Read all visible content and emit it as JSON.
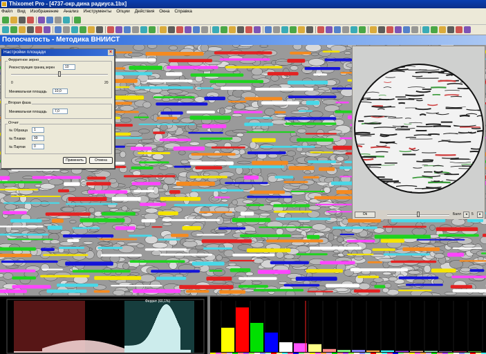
{
  "window": {
    "title": "Thixomet Pro - [4737-окр.дина радиуса.1bx]"
  },
  "menu": [
    "Файл",
    "Вид",
    "Изображение",
    "Анализ",
    "Инструменты",
    "Опции",
    "Действия",
    "Окна",
    "Справка"
  ],
  "document": {
    "title": "Полосчатость - Методика ВНИИСТ"
  },
  "dialog": {
    "title": "Настройки площади",
    "groups": {
      "ferrite": {
        "label": "Ферритное зерно",
        "reconstruct_label": "Реконструкция границ зерен",
        "reconstruct_value": "10",
        "slider_min": "0",
        "slider_max": "20",
        "slider_level": 0.5,
        "min_area_label": "Минимальная площадь",
        "min_area_value": "10,0"
      },
      "second_phase": {
        "label": "Вторая фаза",
        "min_area_label": "Минимальная площадь",
        "min_area_value": "7,0"
      },
      "report": {
        "label": "Отчет",
        "sample_label": "№ Образца",
        "sample_value": "1",
        "melt_label": "№ Плавки",
        "melt_value": "99",
        "batch_label": "№ Партии",
        "batch_value": "0"
      }
    },
    "apply_label": "Применить",
    "cancel_label": "Отмена"
  },
  "zoom_view": {
    "ok_label": "Ok",
    "scale_label": "Балл",
    "scale_value": "5"
  },
  "histogram_left": {
    "overlay_label": "Феррит (60,1%)",
    "colors": {
      "left_region": "#c03030",
      "right_region": "#40b0b0"
    }
  },
  "histogram_right": {
    "chart_data": {
      "type": "bar",
      "values": [
        0.5,
        0.92,
        0.6,
        0.4,
        0.2,
        0.18,
        0.16,
        0.06,
        0.04,
        0.04,
        0.03,
        0.03,
        0.02,
        0.02,
        0.02,
        0.01,
        0.01,
        0.01
      ],
      "colors": [
        "#ffff00",
        "#ff0000",
        "#00e000",
        "#0000ff",
        "#ffffff",
        "#ff55ff",
        "#ffff88",
        "#ff8888",
        "#88ff88",
        "#8888ff",
        "#ffaa44",
        "#44ffff",
        "#aa44ff",
        "#ffccaa",
        "#aaffcc",
        "#ccaaff",
        "#ff4488",
        "#88ff44"
      ]
    }
  },
  "colors": {
    "title_bar": "#0b3aa8",
    "doc_banner": "#1f5fd8",
    "chrome": "#ece9d8",
    "phase_yellow": "#f5e400",
    "phase_red": "#e32222",
    "phase_green": "#1fd31f",
    "phase_blue": "#1414d8",
    "phase_white": "#ffffff",
    "phase_magenta": "#ff44ff",
    "phase_orange": "#f58a1f",
    "phase_cyan": "#48d8e8"
  }
}
